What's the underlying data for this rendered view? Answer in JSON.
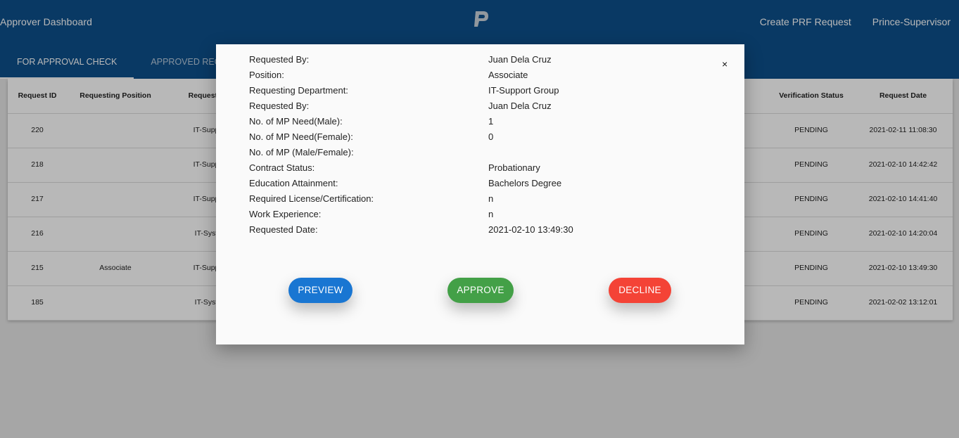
{
  "header": {
    "title": "Approver Dashboard",
    "nav": [
      "Create PRF Request",
      "Prince-Supervisor"
    ],
    "tabs": [
      "FOR APPROVAL CHECK",
      "APPROVED REQUEST"
    ]
  },
  "table": {
    "columns": [
      "Request ID",
      "Requesting Position",
      "Requestin",
      "Verification Status",
      "Request Date"
    ],
    "rows": [
      {
        "id": "220",
        "position": "",
        "dept": "IT-Supp",
        "status": "PENDING",
        "date": "2021-02-11 11:08:30"
      },
      {
        "id": "218",
        "position": "",
        "dept": "IT-Supp",
        "status": "PENDING",
        "date": "2021-02-10 14:42:42"
      },
      {
        "id": "217",
        "position": "",
        "dept": "IT-Supp",
        "status": "PENDING",
        "date": "2021-02-10 14:41:40"
      },
      {
        "id": "216",
        "position": "",
        "dept": "IT-Syst",
        "status": "PENDING",
        "date": "2021-02-10 14:20:04"
      },
      {
        "id": "215",
        "position": "Associate",
        "dept": "IT-Supp",
        "status": "PENDING",
        "date": "2021-02-10 13:49:30"
      },
      {
        "id": "185",
        "position": "",
        "dept": "IT-Syst",
        "status": "PENDING",
        "date": "2021-02-02 13:12:01"
      }
    ]
  },
  "modal": {
    "close": "×",
    "details": [
      {
        "label": "Requested By:",
        "value": "Juan Dela Cruz"
      },
      {
        "label": "Position:",
        "value": "Associate"
      },
      {
        "label": "Requesting Department:",
        "value": "IT-Support Group"
      },
      {
        "label": "Requested By:",
        "value": "Juan Dela Cruz"
      },
      {
        "label": "No. of MP Need(Male):",
        "value": "1"
      },
      {
        "label": "No. of MP Need(Female):",
        "value": "0"
      },
      {
        "label": "No. of MP (Male/Female):",
        "value": ""
      },
      {
        "label": "Contract Status:",
        "value": "Probationary"
      },
      {
        "label": "Education Attainment:",
        "value": "Bachelors Degree"
      },
      {
        "label": "Required License/Certification:",
        "value": "n"
      },
      {
        "label": "Work Experience:",
        "value": "n"
      },
      {
        "label": "Requested Date:",
        "value": "2021-02-10 13:49:30"
      }
    ],
    "buttons": {
      "preview": "PREVIEW",
      "approve": "APPROVE",
      "decline": "DECLINE"
    }
  },
  "colors": {
    "header": "#0d4f8b",
    "preview": "#1976d2",
    "approve": "#43a047",
    "decline": "#f44336"
  }
}
